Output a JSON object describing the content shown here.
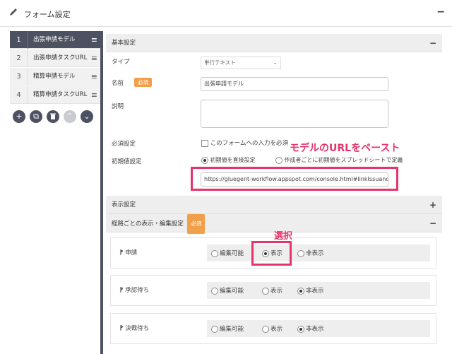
{
  "topbar": {
    "title": "フォーム設定",
    "collapse": "−"
  },
  "nav": {
    "items": [
      {
        "num": "1",
        "label": "出張申請モデル",
        "active": true
      },
      {
        "num": "2",
        "label": "出張申請タスクURL",
        "active": false
      },
      {
        "num": "3",
        "label": "精算申請モデル",
        "active": false
      },
      {
        "num": "4",
        "label": "精算申請タスクURL",
        "active": false
      }
    ],
    "menu_glyph": "≡",
    "actions": [
      {
        "name": "add-icon",
        "glyph": "+"
      },
      {
        "name": "copy-icon",
        "glyph": "⧉"
      },
      {
        "name": "trash-icon",
        "glyph": "🗑"
      },
      {
        "name": "up-icon",
        "glyph": "⌃"
      },
      {
        "name": "down-icon",
        "glyph": "⌄"
      }
    ]
  },
  "basic": {
    "header": "基本設定",
    "ctl": "−",
    "type_label": "タイプ",
    "type_value": "単行テキスト",
    "name_label": "名前",
    "required_badge": "必須",
    "name_value": "出張申請モデル",
    "desc_label": "説明",
    "desc_value": "",
    "required_setting_label": "必須設定",
    "required_checkbox_label": "このフォームへの入力を必須",
    "initial_label": "初期値設定",
    "initial_opt1": "初期値を直接設定",
    "initial_opt2": "作成者ごとに初期値をスプレッドシートで定義",
    "url_value": "https://gluegent-workflow.appspot.com/console.html#linkIssuance"
  },
  "display": {
    "header": "表示設定",
    "ctl": "+"
  },
  "route": {
    "header": "経路ごとの表示・編集設定",
    "badge": "必須",
    "ctl": "−",
    "opt_editable": "編集可能",
    "opt_show": "表示",
    "opt_hide": "非表示",
    "rows": [
      {
        "name": "申請",
        "selected": "show"
      },
      {
        "name": "承認待ち",
        "selected": "hide"
      },
      {
        "name": "決裁待ち",
        "selected": "hide"
      }
    ]
  },
  "annotations": {
    "paste_note": "モデルのURLをペースト",
    "select_note": "選択"
  },
  "colors": {
    "accent": "#e8326a",
    "nav_active": "#4c5261",
    "badge": "#f0a04b"
  }
}
